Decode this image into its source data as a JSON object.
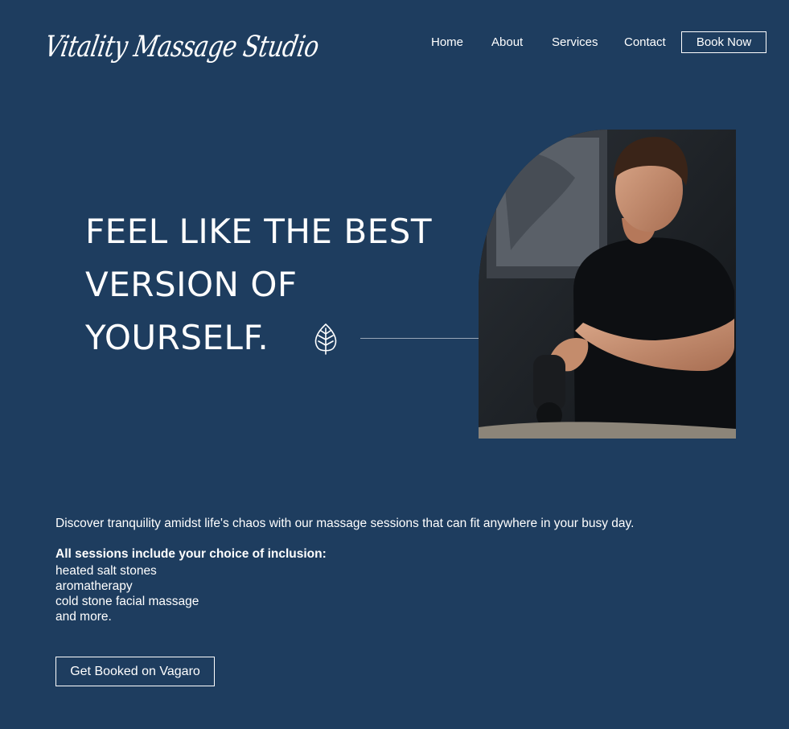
{
  "brand": {
    "logo_text": "Vitality Massage Studio"
  },
  "nav": {
    "items": [
      "Home",
      "About",
      "Services",
      "Contact"
    ],
    "cta": "Book Now"
  },
  "hero": {
    "heading_lines": [
      "FEEL LIKE THE BEST",
      "VERSION OF",
      "YOURSELF."
    ],
    "icon": "leaf-icon",
    "photo_description_icon": "therapist-photo"
  },
  "content": {
    "intro": "Discover tranquility amidst life's chaos with our massage sessions that can fit anywhere in your busy day.",
    "inclusion_heading": "All sessions include your choice of inclusion:",
    "inclusions": [
      "heated salt stones",
      "aromatherapy",
      "cold stone facial massage",
      "and more."
    ],
    "cta": "Get Booked on Vagaro"
  },
  "colors": {
    "background": "#1e3d5f",
    "text": "#ffffff"
  }
}
